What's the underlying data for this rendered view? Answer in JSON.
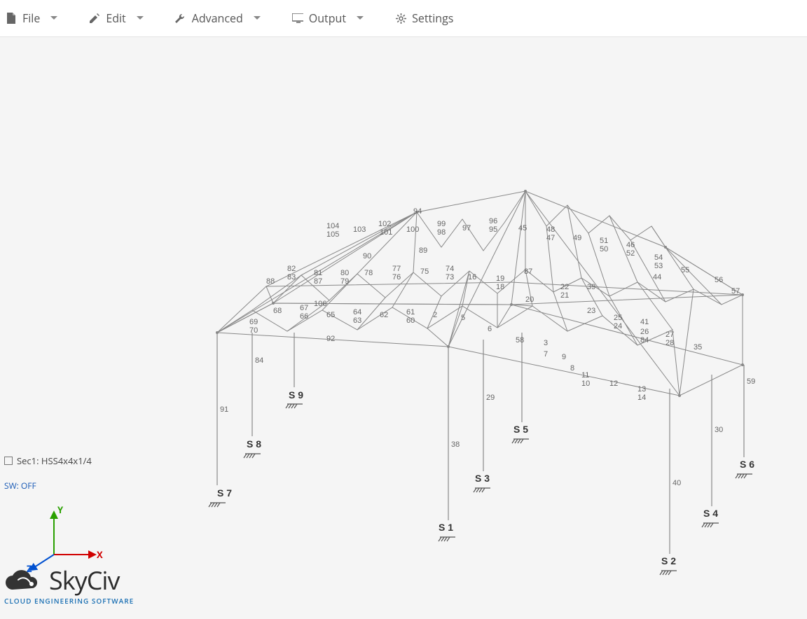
{
  "menu": {
    "file": "File",
    "edit": "Edit",
    "advanced": "Advanced",
    "output": "Output",
    "settings": "Settings"
  },
  "section_label": "Sec1: HSS4x4x1/4",
  "sw_label": "SW: OFF",
  "axis": {
    "x": "X",
    "y": "Y",
    "z": "Z"
  },
  "logo": {
    "brand": "SkyCiv",
    "tagline": "CLOUD ENGINEERING SOFTWARE"
  },
  "supports": [
    "S 1",
    "S 2",
    "S 3",
    "S 4",
    "S 5",
    "S 6",
    "S 7",
    "S 8",
    "S 9"
  ],
  "member_labels": [
    "2",
    "3",
    "5",
    "6",
    "7",
    "8",
    "9",
    "10",
    "11",
    "12",
    "13",
    "14",
    "16",
    "18",
    "19",
    "20",
    "21",
    "22",
    "23",
    "24",
    "25",
    "26",
    "27",
    "28",
    "29",
    "30",
    "35",
    "37",
    "38",
    "39",
    "40",
    "41",
    "44",
    "45",
    "46",
    "47",
    "48",
    "49",
    "50",
    "51",
    "52",
    "53",
    "54",
    "55",
    "56",
    "57",
    "59",
    "60",
    "61",
    "62",
    "63",
    "64",
    "65",
    "66",
    "67",
    "68",
    "69",
    "70",
    "73",
    "74",
    "75",
    "76",
    "77",
    "78",
    "79",
    "80",
    "81",
    "82",
    "83",
    "84",
    "86",
    "87",
    "88",
    "89",
    "91",
    "92",
    "94",
    "95",
    "96",
    "97",
    "98",
    "99",
    "100",
    "101",
    "102",
    "103",
    "104",
    "105",
    "106"
  ]
}
